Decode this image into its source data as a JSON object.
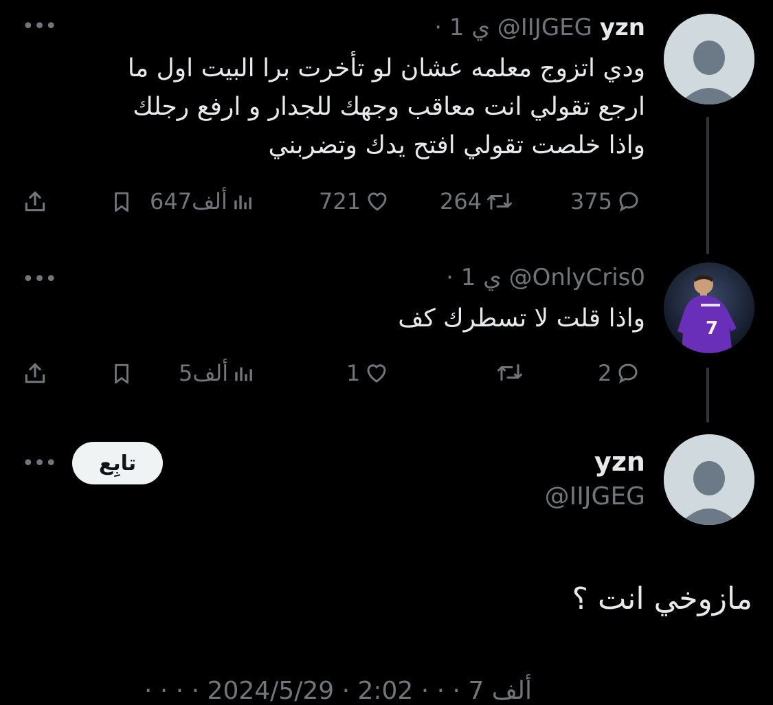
{
  "tweets": [
    {
      "name": "yzn",
      "handle": "@IIJGEG",
      "time": "· 1 ي",
      "text": "ودي اتزوج معلمه عشان لو تأخرت برا البيت اول ما\nارجع تقولي انت معاقب وجهك للجدار و ارفع رجلك\nواذا خلصت تقولي افتح يدك وتضربني",
      "replies": "375",
      "reposts": "264",
      "likes": "721",
      "views": "647ألف"
    },
    {
      "name": "",
      "handle": "@OnlyCris0",
      "time": "· 1 ي",
      "text": "واذا قلت لا تسطرك كف",
      "replies": "2",
      "reposts": "",
      "likes": "1",
      "views": "5ألف",
      "avatar_jersey_number": "7"
    }
  ],
  "main": {
    "name": "yzn",
    "handle": "@IIJGEG",
    "follow_label": "تابِع",
    "text": "مازوخي انت ؟"
  },
  "footer_partial": "· · ·  ·  ألف   7   · ·  · 2:02 · 2024/5/29",
  "icons": {
    "more": "more-dots-icon",
    "reply": "reply-icon",
    "repost": "repost-icon",
    "like": "heart-icon",
    "views": "views-icon",
    "bookmark": "bookmark-icon",
    "share": "share-icon"
  },
  "colors": {
    "background": "#000000",
    "text": "#e7e9ea",
    "muted": "#71767b",
    "thread_line": "#333639",
    "avatar_default": "#cfd9de",
    "jersey": "#6a2fb8"
  }
}
